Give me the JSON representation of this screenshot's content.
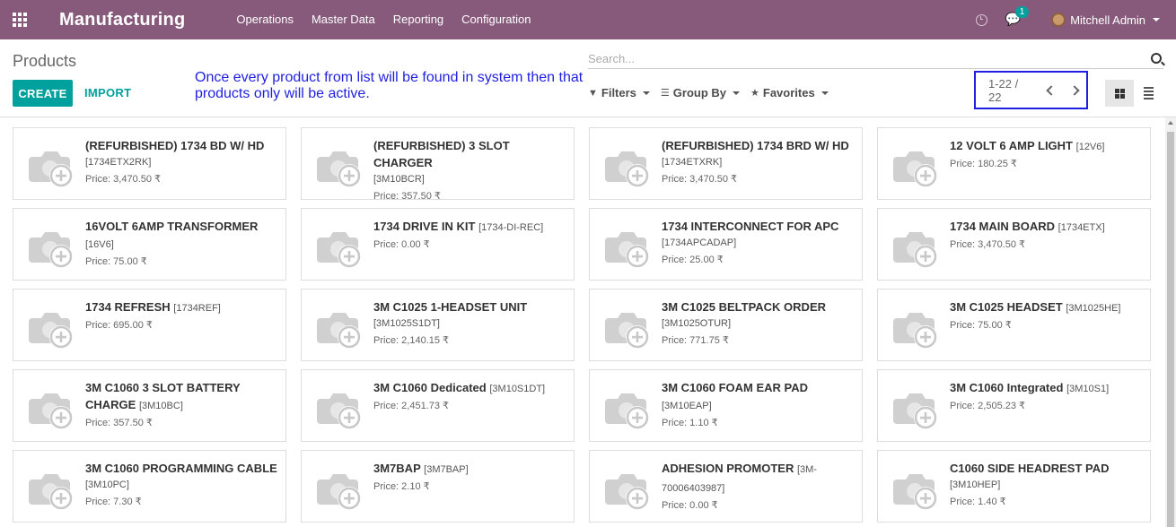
{
  "navbar": {
    "app_name": "Manufacturing",
    "menu": [
      "Operations",
      "Master Data",
      "Reporting",
      "Configuration"
    ],
    "chat_count": "1",
    "user_name": "Mitchell Admin"
  },
  "control": {
    "breadcrumb": "Products",
    "create_label": "CREATE",
    "import_label": "IMPORT",
    "annotation": "Once every product from list will be found in system then that products only will be active.",
    "search_placeholder": "Search...",
    "filters_label": "Filters",
    "groupby_label": "Group By",
    "favorites_label": "Favorites",
    "pager": "1-22 / 22"
  },
  "colors": {
    "brand": "#875a7b",
    "accent": "#00a09d",
    "annotation": "#1f1fe0"
  },
  "products": [
    {
      "name": "(REFURBISHED) 1734 BD W/ HD",
      "code": "[1734ETX2RK]",
      "code_inline": false,
      "price": "Price: 3,470.50 ₹"
    },
    {
      "name": "(REFURBISHED) 3 SLOT CHARGER",
      "code": "[3M10BCR]",
      "code_inline": false,
      "price": "Price: 357.50 ₹"
    },
    {
      "name": "(REFURBISHED) 1734 BRD W/ HD",
      "code": "[1734ETXRK]",
      "code_inline": false,
      "price": "Price: 3,470.50 ₹"
    },
    {
      "name": "12 VOLT 6 AMP LIGHT",
      "code": "[12V6]",
      "code_inline": true,
      "price": "Price: 180.25 ₹"
    },
    {
      "name": "16VOLT 6AMP TRANSFORMER",
      "code": "[16V6]",
      "code_inline": true,
      "price": "Price: 75.00 ₹"
    },
    {
      "name": "1734 DRIVE IN KIT",
      "code": "[1734-DI-REC]",
      "code_inline": true,
      "price": "Price: 0.00 ₹"
    },
    {
      "name": "1734 INTERCONNECT FOR APC",
      "code": "[1734APCADAP]",
      "code_inline": false,
      "price": "Price: 25.00 ₹"
    },
    {
      "name": "1734 MAIN BOARD",
      "code": "[1734ETX]",
      "code_inline": true,
      "price": "Price: 3,470.50 ₹"
    },
    {
      "name": "1734 REFRESH",
      "code": "[1734REF]",
      "code_inline": true,
      "price": "Price: 695.00 ₹"
    },
    {
      "name": "3M C1025 1-HEADSET UNIT",
      "code": "[3M1025S1DT]",
      "code_inline": false,
      "price": "Price: 2,140.15 ₹"
    },
    {
      "name": "3M C1025 BELTPACK ORDER",
      "code": "[3M1025OTUR]",
      "code_inline": false,
      "price": "Price: 771.75 ₹"
    },
    {
      "name": "3M C1025 HEADSET",
      "code": "[3M1025HE]",
      "code_inline": true,
      "price": "Price: 75.00 ₹"
    },
    {
      "name": "3M C1060 3 SLOT BATTERY CHARGE",
      "code": "[3M10BC]",
      "code_inline": true,
      "price": "Price: 357.50 ₹"
    },
    {
      "name": "3M C1060 Dedicated",
      "code": "[3M10S1DT]",
      "code_inline": true,
      "price": "Price: 2,451.73 ₹"
    },
    {
      "name": "3M C1060 FOAM EAR PAD",
      "code": "[3M10EAP]",
      "code_inline": true,
      "price": "Price: 1.10 ₹"
    },
    {
      "name": "3M C1060 Integrated",
      "code": "[3M10S1]",
      "code_inline": true,
      "price": "Price: 2,505.23 ₹"
    },
    {
      "name": "3M C1060 PROGRAMMING CABLE",
      "code": "[3M10PC]",
      "code_inline": false,
      "price": "Price: 7.30 ₹"
    },
    {
      "name": "3M7BAP",
      "code": "[3M7BAP]",
      "code_inline": true,
      "price": "Price: 2.10 ₹"
    },
    {
      "name": "ADHESION PROMOTER",
      "code": "[3M-70006403987]",
      "code_inline": true,
      "price": "Price: 0.00 ₹"
    },
    {
      "name": "C1060 SIDE HEADREST PAD",
      "code": "[3M10HEP]",
      "code_inline": false,
      "price": "Price: 1.40 ₹"
    }
  ]
}
